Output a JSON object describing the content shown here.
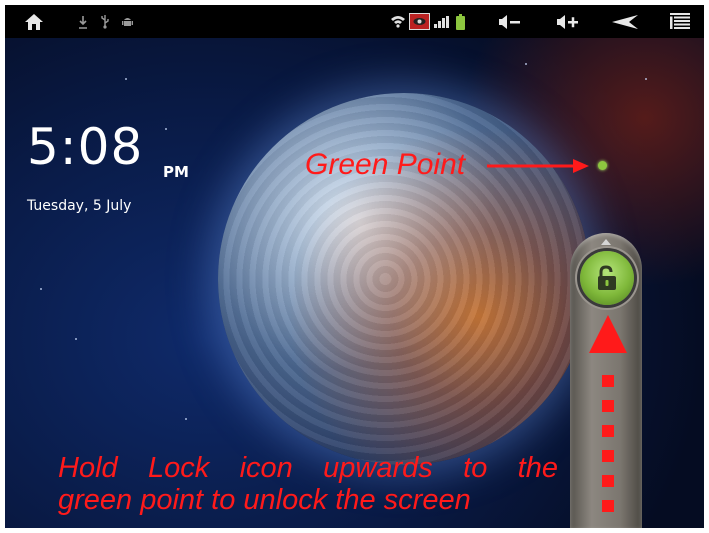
{
  "status_bar": {
    "icons": [
      "home-icon",
      "download-icon",
      "usb-icon",
      "android-debug-icon",
      "wifi-icon",
      "notification-icon",
      "signal-icon",
      "battery-icon",
      "volume-down-icon",
      "volume-up-icon",
      "back-icon",
      "menu-icon"
    ]
  },
  "lockscreen": {
    "time": "5:08",
    "ampm": "PM",
    "date": "Tuesday, 5 July"
  },
  "annotations": {
    "green_point_label": "Green Point",
    "hint_line1": "Hold Lock icon upwards to the",
    "hint_line2": "green point to unlock the screen"
  },
  "colors": {
    "annotation": "#ff1a1a",
    "green_point": "#8dc63f",
    "lock_button": "#7fb83a"
  }
}
